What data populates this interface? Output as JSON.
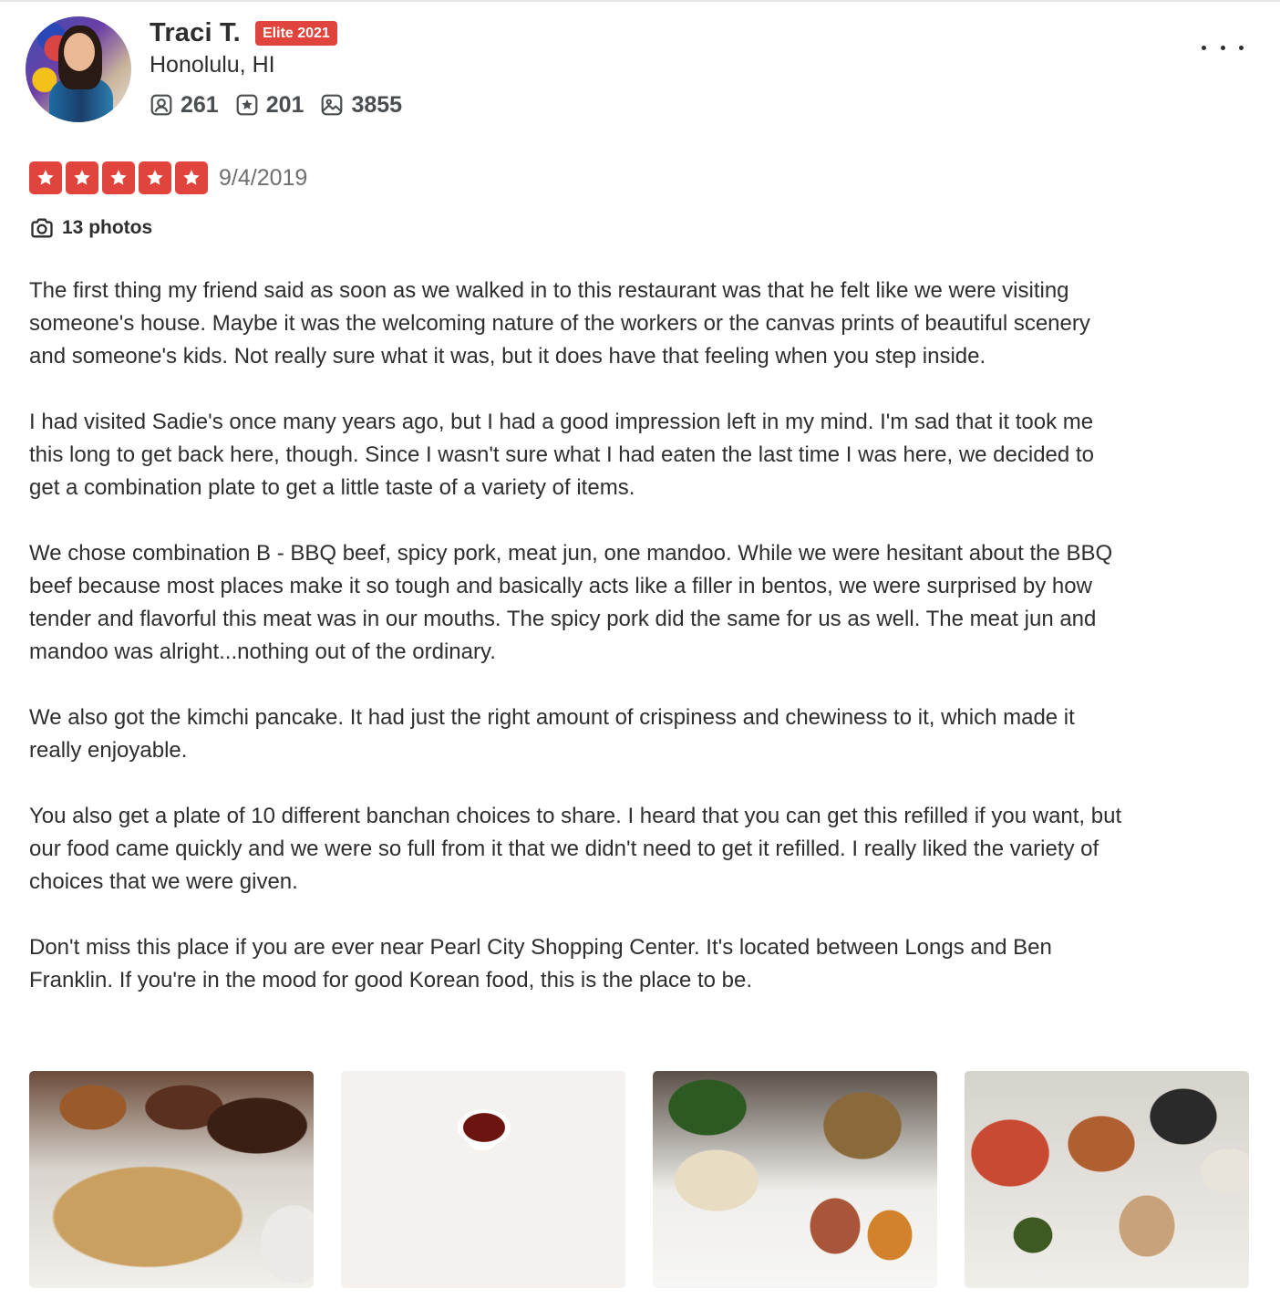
{
  "colors": {
    "accent_red": "#e0443c",
    "star_red": "#e0443c",
    "text_primary": "#2d2e2f",
    "text_secondary": "#6e7072"
  },
  "reviewer": {
    "name": "Traci T.",
    "elite_badge": "Elite 2021",
    "location": "Honolulu, HI",
    "stats": {
      "friends": "261",
      "reviews": "201",
      "photos": "3855"
    },
    "stat_icons": [
      "friends-icon",
      "reviews-icon",
      "photos-icon"
    ],
    "avatar_icon": "avatar"
  },
  "more_menu_icon": "more-options-icon",
  "rating": {
    "stars": 5,
    "max_stars": 5,
    "date": "9/4/2019"
  },
  "photos_link": {
    "icon": "camera-icon",
    "label": "13 photos"
  },
  "review": {
    "paragraphs": [
      "The first thing my friend said as soon as we walked in to this restaurant was that he felt like we were visiting someone's house.  Maybe it was the welcoming nature of the workers or the canvas prints of beautiful scenery and someone's kids.  Not really sure what it was, but it does have that feeling when you step inside.",
      "I had visited Sadie's once many years ago, but I had a good impression left in my mind.  I'm sad that it took me this long to get back here, though.  Since I wasn't sure what I had eaten the last time I was here, we decided to get a combination plate to get a little taste of a variety of items.",
      "We chose combination B - BBQ beef, spicy pork, meat jun, one mandoo.  While we were hesitant about the BBQ beef because most places make it so tough and basically acts like a filler in bentos, we were surprised by how tender and flavorful this meat was in our mouths.  The spicy pork did the same for us as well.  The meat jun and mandoo was alright...nothing out of the ordinary.",
      "We also got the kimchi pancake.  It had just the right amount of crispiness and chewiness to it, which made it really enjoyable.",
      "You also get a plate of 10 different banchan choices to share.  I heard that you can get this refilled if you want, but our food came quickly and we were so full from it that we didn't need to get it refilled.  I really liked the variety of choices that we were given.",
      "Don't miss this place if you are ever near Pearl City Shopping Center.  It's located between Longs and Ben Franklin.  If you're in the mood for good Korean food, this is the place to be."
    ]
  }
}
